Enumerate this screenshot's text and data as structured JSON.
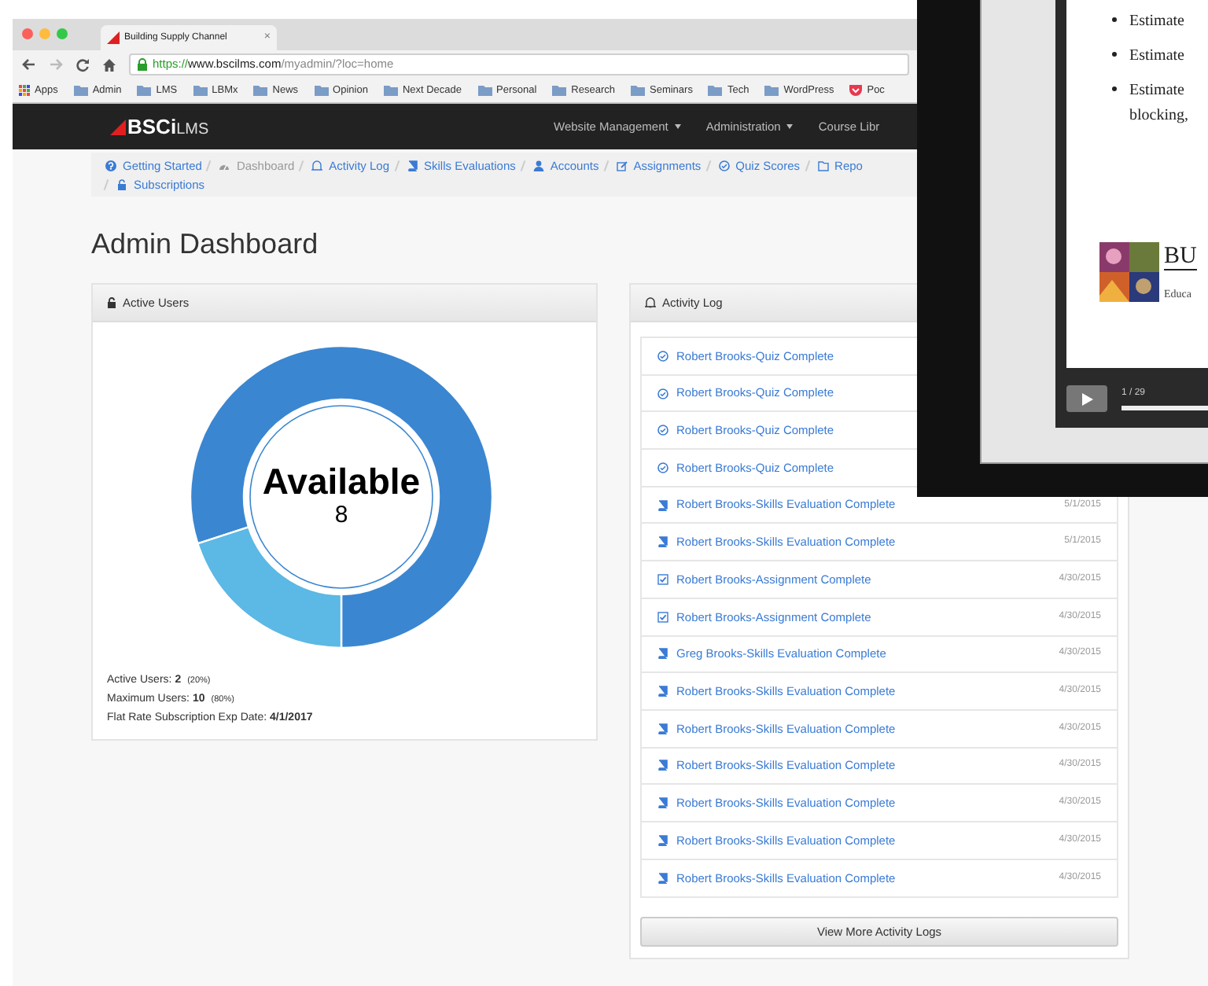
{
  "browser": {
    "tab": {
      "title": "Building Supply Channel",
      "close": "×"
    },
    "url": {
      "scheme": "https://",
      "host": "www.bscilms.com",
      "path": "/myadmin/?loc=home"
    },
    "bookmarks": [
      {
        "kind": "apps",
        "label": "Apps"
      },
      {
        "kind": "folder",
        "label": "Admin"
      },
      {
        "kind": "folder",
        "label": "LMS"
      },
      {
        "kind": "folder",
        "label": "LBMx"
      },
      {
        "kind": "folder",
        "label": "News"
      },
      {
        "kind": "folder",
        "label": "Opinion"
      },
      {
        "kind": "folder",
        "label": "Next Decade"
      },
      {
        "kind": "folder",
        "label": "Personal"
      },
      {
        "kind": "folder",
        "label": "Research"
      },
      {
        "kind": "folder",
        "label": "Seminars"
      },
      {
        "kind": "folder",
        "label": "Tech"
      },
      {
        "kind": "folder",
        "label": "WordPress"
      },
      {
        "kind": "pocket",
        "label": "Poc"
      }
    ]
  },
  "navbar": {
    "logo": {
      "bold": "BSCi",
      "light": "LMS"
    },
    "menu": [
      {
        "label": "Website Management",
        "dropdown": true
      },
      {
        "label": "Administration",
        "dropdown": true
      },
      {
        "label": "Course Libr",
        "dropdown": false
      }
    ]
  },
  "breadcrumbs": [
    {
      "kind": "help",
      "label": "Getting Started",
      "selected": false
    },
    {
      "kind": "dashboard",
      "label": "Dashboard",
      "selected": true
    },
    {
      "kind": "bell",
      "label": "Activity Log",
      "selected": false
    },
    {
      "kind": "book",
      "label": "Skills Evaluations",
      "selected": false
    },
    {
      "kind": "user",
      "label": "Accounts",
      "selected": false
    },
    {
      "kind": "edit",
      "label": "Assignments",
      "selected": false
    },
    {
      "kind": "quiz",
      "label": "Quiz Scores",
      "selected": false
    },
    {
      "kind": "folder",
      "label": "Repo",
      "selected": false
    },
    {
      "kind": "lock",
      "label": "Subscriptions",
      "selected": false
    }
  ],
  "page_title": "Admin Dashboard",
  "active_users": {
    "title": "Active Users",
    "chart_data": {
      "type": "donut",
      "series": [
        {
          "values": [
            80,
            20
          ]
        }
      ]
    },
    "center_label": "Available",
    "center_value": "8",
    "stats": [
      {
        "label": "Active Users:",
        "value": "2",
        "note": "(20%)"
      },
      {
        "label": "Maximum Users:",
        "value": "10",
        "note": "(80%)"
      },
      {
        "label": "Flat Rate Subscription Exp Date:",
        "value": "4/1/2017"
      }
    ]
  },
  "activity_log": {
    "title": "Activity Log",
    "rows": [
      {
        "kind": "quiz",
        "text": "Robert Brooks-Quiz Complete"
      },
      {
        "kind": "quiz",
        "text": "Robert Brooks-Quiz Complete"
      },
      {
        "kind": "quiz",
        "text": "Robert Brooks-Quiz Complete"
      },
      {
        "kind": "quiz",
        "text": "Robert Brooks-Quiz Complete"
      },
      {
        "kind": "skills",
        "text": "Robert Brooks-Skills Evaluation Complete",
        "date": "5/1/2015"
      },
      {
        "kind": "skills",
        "text": "Robert Brooks-Skills Evaluation Complete",
        "date": "5/1/2015"
      },
      {
        "kind": "assignment",
        "text": "Robert Brooks-Assignment Complete",
        "date": "4/30/2015"
      },
      {
        "kind": "assignment",
        "text": "Robert Brooks-Assignment Complete",
        "date": "4/30/2015"
      },
      {
        "kind": "skills",
        "text": "Greg Brooks-Skills Evaluation Complete",
        "date": "4/30/2015"
      },
      {
        "kind": "skills",
        "text": "Robert Brooks-Skills Evaluation Complete",
        "date": "4/30/2015"
      },
      {
        "kind": "skills",
        "text": "Robert Brooks-Skills Evaluation Complete",
        "date": "4/30/2015"
      },
      {
        "kind": "skills",
        "text": "Robert Brooks-Skills Evaluation Complete",
        "date": "4/30/2015"
      },
      {
        "kind": "skills",
        "text": "Robert Brooks-Skills Evaluation Complete",
        "date": "4/30/2015"
      },
      {
        "kind": "skills",
        "text": "Robert Brooks-Skills Evaluation Complete",
        "date": "4/30/2015"
      },
      {
        "kind": "skills",
        "text": "Robert Brooks-Skills Evaluation Complete",
        "date": "4/30/2015"
      }
    ],
    "more_button": "View More Activity Logs"
  },
  "video_player": {
    "slide": {
      "bullets": [
        {
          "lines": [
            "Estimate"
          ]
        },
        {
          "lines": [
            "Estimate"
          ]
        },
        {
          "lines": [
            "Estimate",
            "blocking,"
          ]
        }
      ],
      "logo_title": "BU",
      "logo_subtitle": "Educa"
    },
    "time": "1 / 29"
  }
}
